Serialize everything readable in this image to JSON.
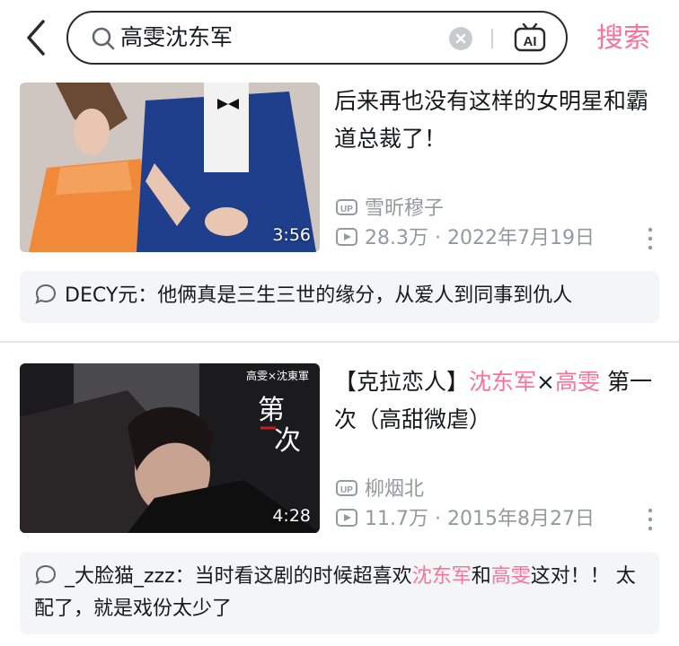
{
  "search": {
    "query": "高雯沈东军",
    "submit_label": "搜索"
  },
  "videos": [
    {
      "title": "后来再也没有这样的女明星和霸道总裁了！",
      "duration": "3:56",
      "uploader": "雪昕穆子",
      "views": "28.3万",
      "date": "2022年7月19日",
      "comment": {
        "user": "DECY元",
        "text": "他俩真是三生三世的缘分，从爱人到同事到仇人"
      }
    },
    {
      "title_parts": [
        "【克拉恋人】",
        "沈东军",
        "×",
        "高雯",
        " 第一次（高甜微虐）"
      ],
      "duration": "4:28",
      "thumb_overlay": {
        "names": "高雯×沈東軍",
        "big": "第一次"
      },
      "uploader": "柳烟北",
      "views": "11.7万",
      "date": "2015年8月27日",
      "comment": {
        "user": "_大脸猫_zzz",
        "text_parts": [
          "当时看这剧的时候超喜欢",
          "沈东军",
          "和",
          "高雯",
          "这对！！ 太配了，就是戏份太少了"
        ]
      }
    }
  ],
  "colors": {
    "accent": "#fb7299",
    "meta": "#9499a0",
    "comment_bg": "#f4f5f7"
  },
  "icons": [
    "back-arrow-icon",
    "search-icon",
    "clear-icon",
    "ai-tv-icon",
    "up-badge-icon",
    "play-icon",
    "more-icon",
    "comment-bubble-icon"
  ]
}
